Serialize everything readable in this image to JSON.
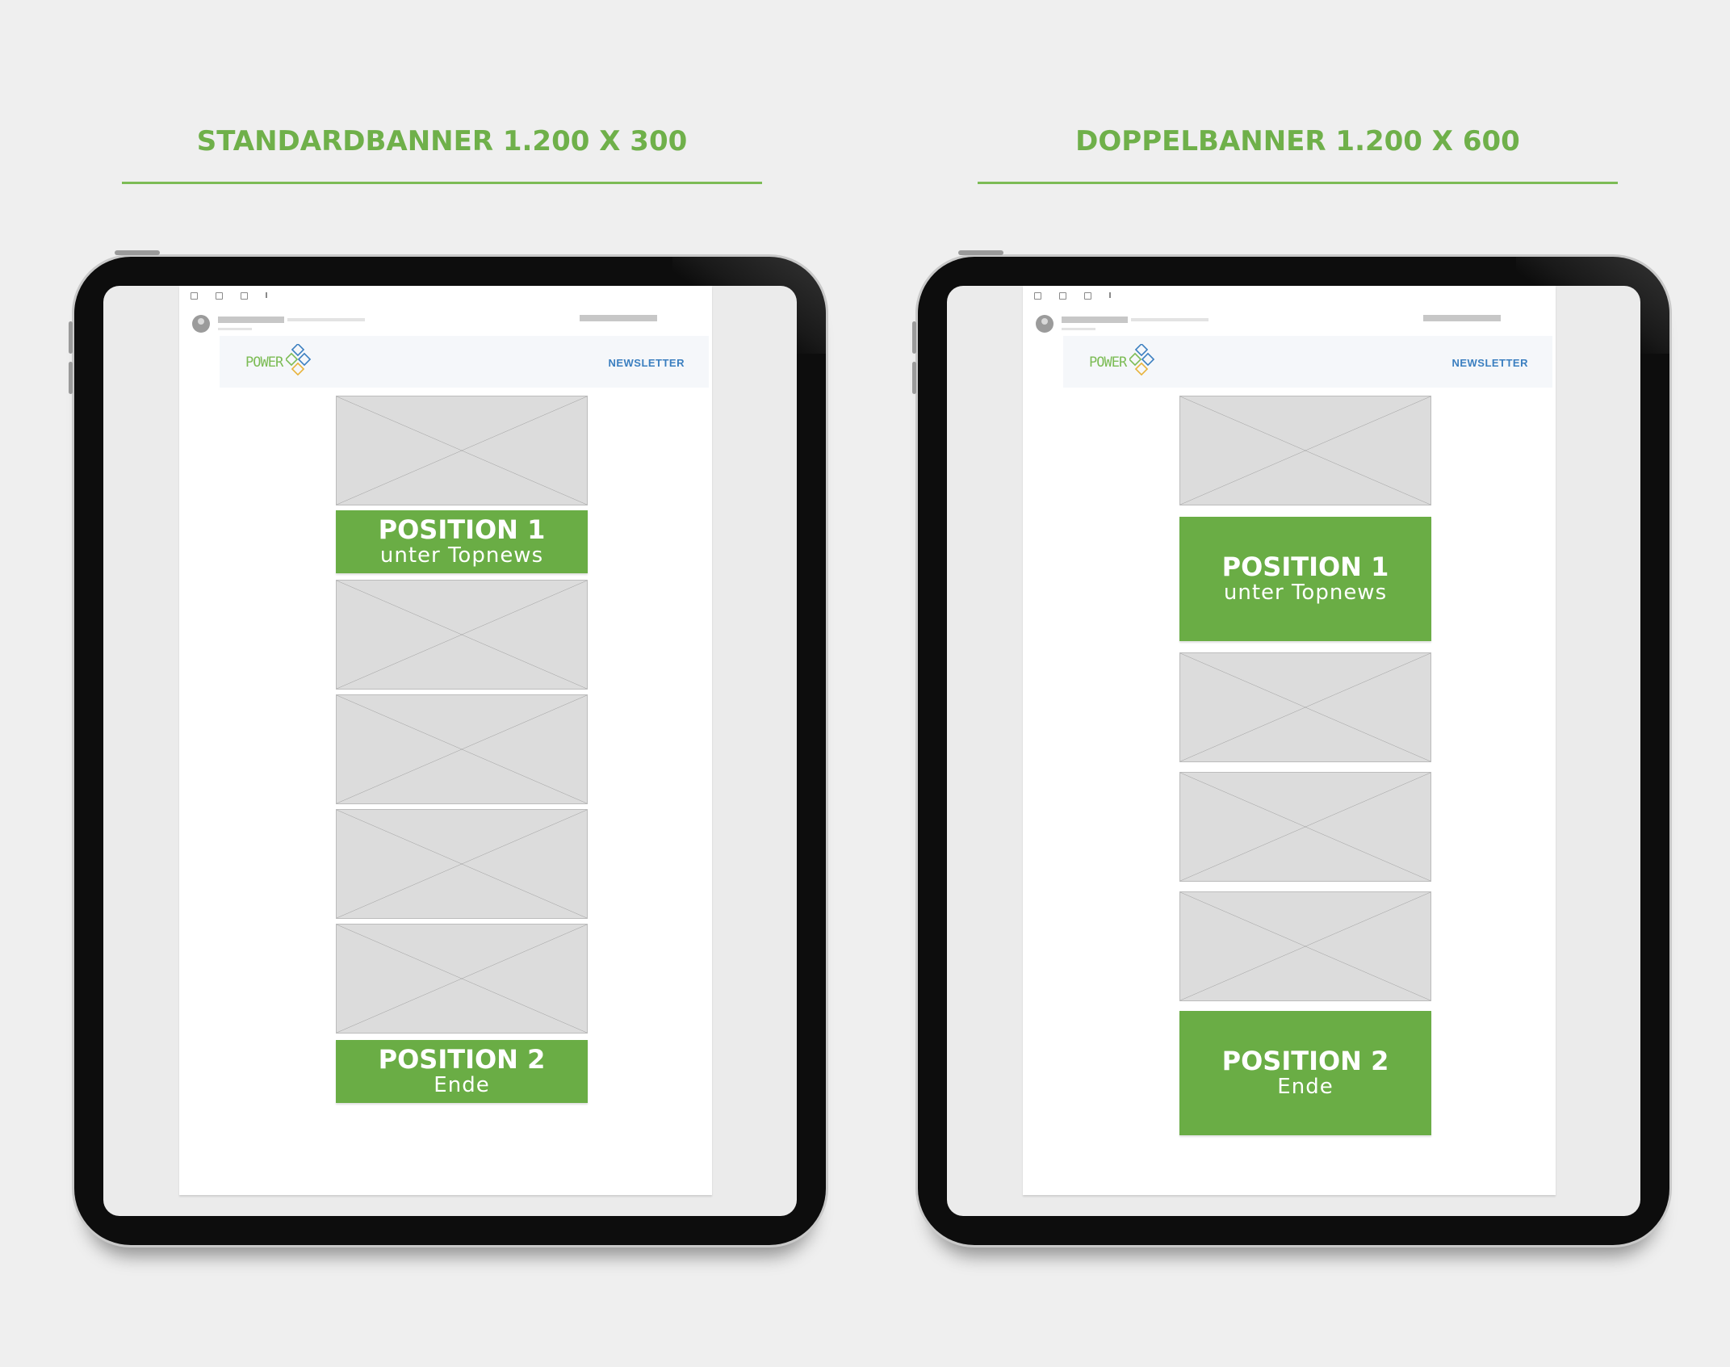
{
  "colors": {
    "accent_green": "#6aad45",
    "title_green": "#6fb04a",
    "link_blue": "#3b7fc0",
    "background": "#efefef"
  },
  "left": {
    "title": "STANDARDBANNER 1.200 X 300",
    "header": {
      "logo_text": "POWER",
      "link_label": "NEWSLETTER"
    },
    "banners": [
      {
        "title": "POSITION 1",
        "subtitle": "unter Topnews"
      },
      {
        "title": "POSITION 2",
        "subtitle": "Ende"
      }
    ]
  },
  "right": {
    "title": "DOPPELBANNER 1.200 X 600",
    "header": {
      "logo_text": "POWER",
      "link_label": "NEWSLETTER"
    },
    "banners": [
      {
        "title": "POSITION 1",
        "subtitle": "unter Topnews"
      },
      {
        "title": "POSITION 2",
        "subtitle": "Ende"
      }
    ]
  },
  "icons": {
    "logo": "power-logo-icon",
    "avatar": "avatar-icon",
    "toolbar": [
      "archive-icon",
      "delete-icon",
      "label-icon",
      "more-icon"
    ]
  }
}
